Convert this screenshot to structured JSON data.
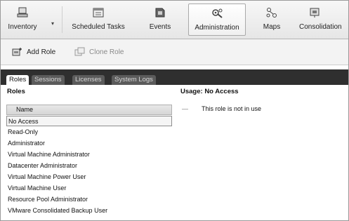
{
  "toolbar": {
    "items": [
      {
        "label": "Inventory",
        "icon": "inventory-icon"
      },
      {
        "label": "Scheduled Tasks",
        "icon": "scheduled-tasks-icon"
      },
      {
        "label": "Events",
        "icon": "events-icon"
      },
      {
        "label": "Administration",
        "icon": "administration-icon",
        "active": true
      },
      {
        "label": "Maps",
        "icon": "maps-icon"
      },
      {
        "label": "Consolidation",
        "icon": "consolidation-icon"
      }
    ]
  },
  "actions": {
    "add_role": "Add Role",
    "clone_role": "Clone Role"
  },
  "tabs": [
    {
      "label": "Roles",
      "active": true
    },
    {
      "label": "Sessions"
    },
    {
      "label": "Licenses"
    },
    {
      "label": "System Logs"
    }
  ],
  "roles_panel": {
    "heading": "Roles",
    "column_header": "Name",
    "rows": [
      "No Access",
      "Read-Only",
      "Administrator",
      "Virtual Machine Administrator",
      "Datacenter Administrator",
      "Virtual Machine Power User",
      "Virtual Machine User",
      "Resource Pool Administrator",
      "VMware Consolidated Backup User"
    ],
    "selected_index": 0
  },
  "usage_panel": {
    "heading": "Usage: No Access",
    "dash": "—",
    "message": "This role is not in use"
  }
}
